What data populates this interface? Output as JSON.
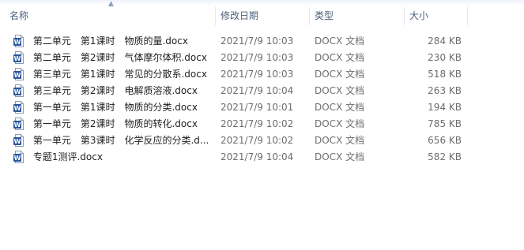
{
  "columns": {
    "name": "名称",
    "date": "修改日期",
    "type": "类型",
    "size": "大小"
  },
  "sort": {
    "column": "name",
    "direction": "ascending"
  },
  "icon": {
    "name": "word-document-icon",
    "color": "#2b579a"
  },
  "files": [
    {
      "name": "第二单元　第1课时　物质的量.docx",
      "date": "2021/7/9 10:03",
      "type": "DOCX 文档",
      "size": "284 KB"
    },
    {
      "name": "第二单元　第2课时　气体摩尔体积.docx",
      "date": "2021/7/9 10:03",
      "type": "DOCX 文档",
      "size": "230 KB"
    },
    {
      "name": "第三单元　第1课时　常见的分散系.docx",
      "date": "2021/7/9 10:03",
      "type": "DOCX 文档",
      "size": "518 KB"
    },
    {
      "name": "第三单元　第2课时　电解质溶液.docx",
      "date": "2021/7/9 10:04",
      "type": "DOCX 文档",
      "size": "263 KB"
    },
    {
      "name": "第一单元　第1课时　物质的分类.docx",
      "date": "2021/7/9 10:01",
      "type": "DOCX 文档",
      "size": "194 KB"
    },
    {
      "name": "第一单元　第2课时　物质的转化.docx",
      "date": "2021/7/9 10:02",
      "type": "DOCX 文档",
      "size": "785 KB"
    },
    {
      "name": "第一单元　第3课时　化学反应的分类.d...",
      "date": "2021/7/9 10:02",
      "type": "DOCX 文档",
      "size": "656 KB"
    },
    {
      "name": "专题1测评.docx",
      "date": "2021/7/9 10:04",
      "type": "DOCX 文档",
      "size": "582 KB"
    }
  ]
}
